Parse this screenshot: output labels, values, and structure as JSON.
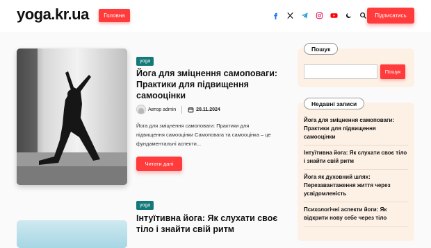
{
  "header": {
    "logo": "yoga.kr.ua",
    "nav": {
      "home_label": "Головна"
    },
    "social_icons": [
      "facebook-icon",
      "x-icon",
      "telegram-icon",
      "instagram-icon",
      "youtube-icon",
      "dark-mode-icon",
      "search-icon"
    ],
    "subscribe_label": "Підписатись"
  },
  "posts": [
    {
      "tag": "yoga",
      "title": "Йога для зміцнення самоповаги: Практики для підвищення самооцінки",
      "author": "Автор admin",
      "date": "28.11.2024",
      "excerpt": "Йога для зміцнення самоповаги: Практики для підвищення самооцінки Самоповага та самооцінка – це фундаментальні аспекти...",
      "read_more": "Читати далі"
    },
    {
      "tag": "yoga",
      "title": "Інтуїтивна йога: Як слухати своє тіло і знайти свій ритм"
    }
  ],
  "sidebar": {
    "search": {
      "title": "Пошук",
      "placeholder": "",
      "button": "Пошук"
    },
    "recent": {
      "title": "Недавні записи",
      "items": [
        "Йога для зміцнення самоповаги: Практики для підвищення самооцінки",
        "Інтуїтивна йога: Як слухати своє тіло і знайти свій ритм",
        "Йога як духовний шлях: Перезавантаження життя через усвідомленість",
        "Психологічні аспекти йоги: Як відкрити нову себе через тіло"
      ]
    }
  },
  "colors": {
    "accent": "#ff3b3b",
    "tag": "#147a79",
    "widget_bg": "#fdf1e6"
  }
}
